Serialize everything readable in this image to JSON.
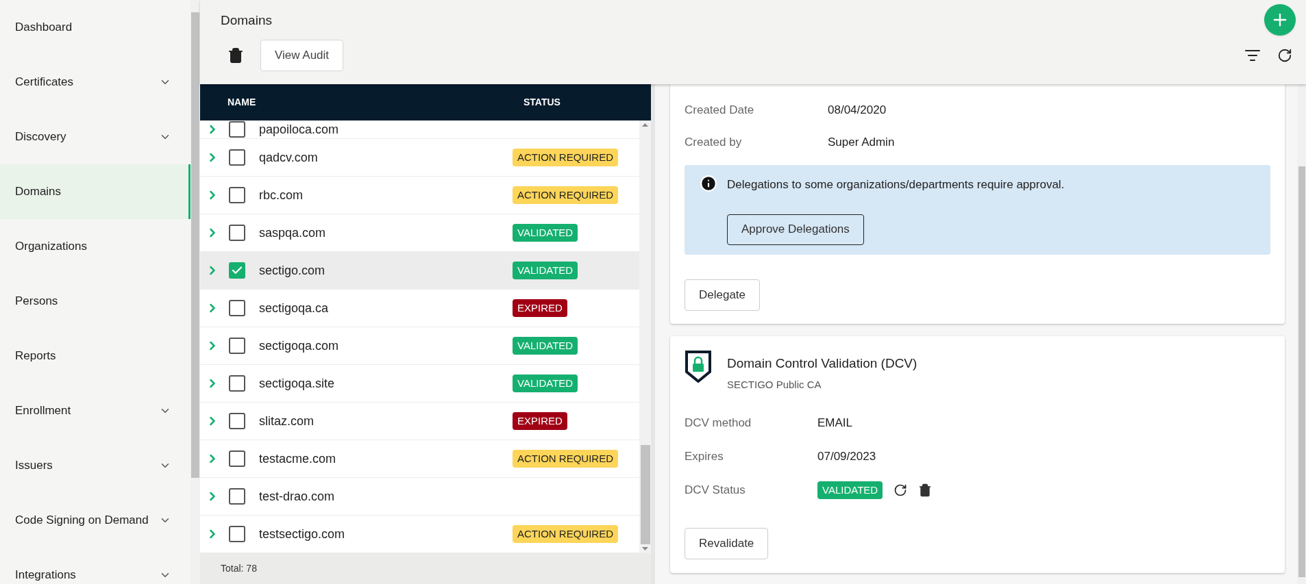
{
  "sidebar": {
    "items": [
      {
        "label": "Dashboard",
        "has_submenu": false,
        "selected": false
      },
      {
        "label": "Certificates",
        "has_submenu": true,
        "selected": false
      },
      {
        "label": "Discovery",
        "has_submenu": true,
        "selected": false
      },
      {
        "label": "Domains",
        "has_submenu": false,
        "selected": true
      },
      {
        "label": "Organizations",
        "has_submenu": false,
        "selected": false
      },
      {
        "label": "Persons",
        "has_submenu": false,
        "selected": false
      },
      {
        "label": "Reports",
        "has_submenu": false,
        "selected": false
      },
      {
        "label": "Enrollment",
        "has_submenu": true,
        "selected": false
      },
      {
        "label": "Issuers",
        "has_submenu": true,
        "selected": false
      },
      {
        "label": "Code Signing on Demand",
        "has_submenu": true,
        "selected": false
      },
      {
        "label": "Integrations",
        "has_submenu": true,
        "selected": false
      }
    ]
  },
  "header": {
    "title": "Domains",
    "toolbar": {
      "button": "View Audit"
    }
  },
  "table": {
    "columns": [
      "NAME",
      "STATUS"
    ],
    "rows": [
      {
        "name": "papoiloca.com",
        "checked": false,
        "selected": false,
        "status": null
      },
      {
        "name": "qadcv.com",
        "checked": false,
        "selected": false,
        "status": {
          "label": "ACTION REQUIRED",
          "kind": "action"
        }
      },
      {
        "name": "rbc.com",
        "checked": false,
        "selected": false,
        "status": {
          "label": "ACTION REQUIRED",
          "kind": "action"
        }
      },
      {
        "name": "saspqa.com",
        "checked": false,
        "selected": false,
        "status": {
          "label": "VALIDATED",
          "kind": "validated"
        }
      },
      {
        "name": "sectigo.com",
        "checked": true,
        "selected": true,
        "status": {
          "label": "VALIDATED",
          "kind": "validated"
        }
      },
      {
        "name": "sectigoqa.ca",
        "checked": false,
        "selected": false,
        "status": {
          "label": "EXPIRED",
          "kind": "expired"
        }
      },
      {
        "name": "sectigoqa.com",
        "checked": false,
        "selected": false,
        "status": {
          "label": "VALIDATED",
          "kind": "validated"
        }
      },
      {
        "name": "sectigoqa.site",
        "checked": false,
        "selected": false,
        "status": {
          "label": "VALIDATED",
          "kind": "validated"
        }
      },
      {
        "name": "slitaz.com",
        "checked": false,
        "selected": false,
        "status": {
          "label": "EXPIRED",
          "kind": "expired"
        }
      },
      {
        "name": "testacme.com",
        "checked": false,
        "selected": false,
        "status": {
          "label": "ACTION REQUIRED",
          "kind": "action"
        }
      },
      {
        "name": "test-drao.com",
        "checked": false,
        "selected": false,
        "status": null
      },
      {
        "name": "testsectigo.com",
        "checked": false,
        "selected": false,
        "status": {
          "label": "ACTION REQUIRED",
          "kind": "action"
        }
      }
    ],
    "footer": "Total: 78"
  },
  "details": {
    "fields": [
      {
        "label": "Created Date",
        "value": "08/04/2020"
      },
      {
        "label": "Created by",
        "value": "Super Admin"
      }
    ],
    "info": {
      "message": "Delegations to some organizations/departments require approval.",
      "button": "Approve Delegations"
    },
    "button": "Delegate"
  },
  "dcv": {
    "title": "Domain Control Validation (DCV)",
    "subtitle": "SECTIGO Public CA",
    "fields": [
      {
        "label": "DCV method",
        "kind": "text",
        "value": "EMAIL"
      },
      {
        "label": "Expires",
        "kind": "text",
        "value": "07/09/2023"
      },
      {
        "label": "DCV Status",
        "kind": "status",
        "status": {
          "label": "VALIDATED",
          "kind": "validated"
        }
      }
    ],
    "button": "Revalidate"
  }
}
